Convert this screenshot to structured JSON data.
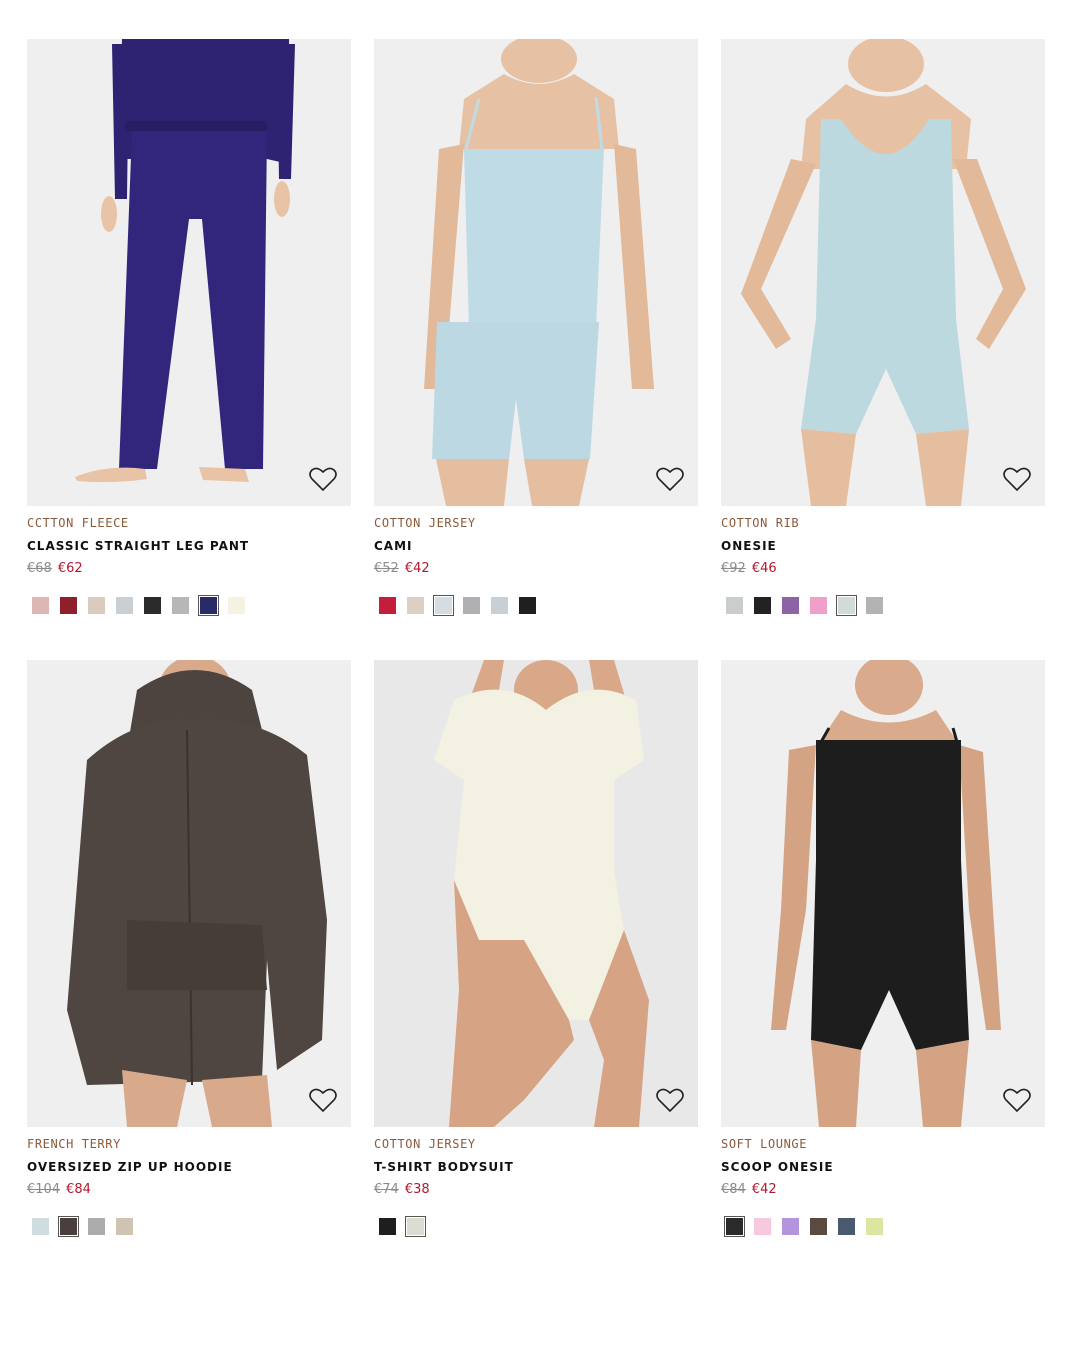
{
  "products": [
    {
      "material": "CCTTON FLEECE",
      "name": "CLASSIC STRAIGHT LEG PANT",
      "old_price": "€68",
      "sale_price": "€62",
      "swatches": [
        "#dcb7b3",
        "#8f1f2a",
        "#d9cbbd",
        "#c9cfd3",
        "#2b2b2b",
        "#b6b7b9",
        "#2a2a66",
        "#f6f2e1"
      ],
      "selected_swatch": 6
    },
    {
      "material": "COTTON JERSEY",
      "name": "CAMI",
      "old_price": "€52",
      "sale_price": "€42",
      "swatches": [
        "#c41e3a",
        "#ddd0c3",
        "#d5dde3",
        "#b0b0b2",
        "#c9d0d5",
        "#1f1f1f"
      ],
      "selected_swatch": 2
    },
    {
      "material": "COTTON RIB",
      "name": "ONESIE",
      "old_price": "€92",
      "sale_price": "€46",
      "swatches": [
        "#c9cdce",
        "#222222",
        "#8e63a5",
        "#f0a0c8",
        "#d2dbd9",
        "#b3b3b5"
      ],
      "selected_swatch": 4
    },
    {
      "material": "FRENCH TERRY",
      "name": "OVERSIZED ZIP UP HOODIE",
      "old_price": "€104",
      "sale_price": "€84",
      "swatches": [
        "#cfdde0",
        "#4a3f3a",
        "#acacae",
        "#cfc3b2"
      ],
      "selected_swatch": 1
    },
    {
      "material": "COTTON JERSEY",
      "name": "T-SHIRT BODYSUIT",
      "old_price": "€74",
      "sale_price": "€38",
      "swatches": [
        "#1e1e1e",
        "#dcdcd2"
      ],
      "selected_swatch": 1
    },
    {
      "material": "SOFT LOUNGE",
      "name": "SCOOP ONESIE",
      "old_price": "€84",
      "sale_price": "€42",
      "swatches": [
        "#2a2a2a",
        "#f6c9de",
        "#b495dd",
        "#5a4a40",
        "#4a5a6e",
        "#dde6a0"
      ],
      "selected_swatch": 0
    }
  ],
  "icons": {
    "wishlist": "heart-outline-icon"
  }
}
